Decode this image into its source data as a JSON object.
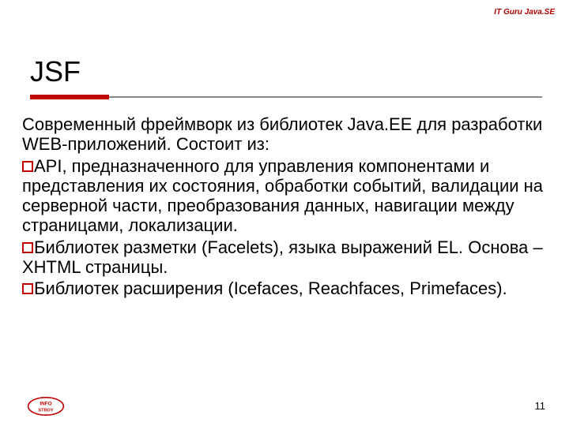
{
  "header": {
    "brand": "IT Guru Java.SE"
  },
  "slide": {
    "title": "JSF",
    "intro": "Современный фреймворк из библиотек Java.EE для разработки WEB-приложений. Состоит из:",
    "bullets": [
      "API, предназначенного для управления компонентами и представления их состояния, обработки событий, валидации на серверной части, преобразования данных, навигации между страницами, локализации.",
      "Библиотек разметки (Facelets), языка выражений EL. Основа – XHTML страницы.",
      "Библиотек расширения (Icefaces, Reachfaces, Primefaces)."
    ]
  },
  "footer": {
    "page_number": "11",
    "logo_text_top": "INFO",
    "logo_text_bottom": "STROY"
  },
  "colors": {
    "accent": "#c00000",
    "rule_gray": "#888888"
  }
}
